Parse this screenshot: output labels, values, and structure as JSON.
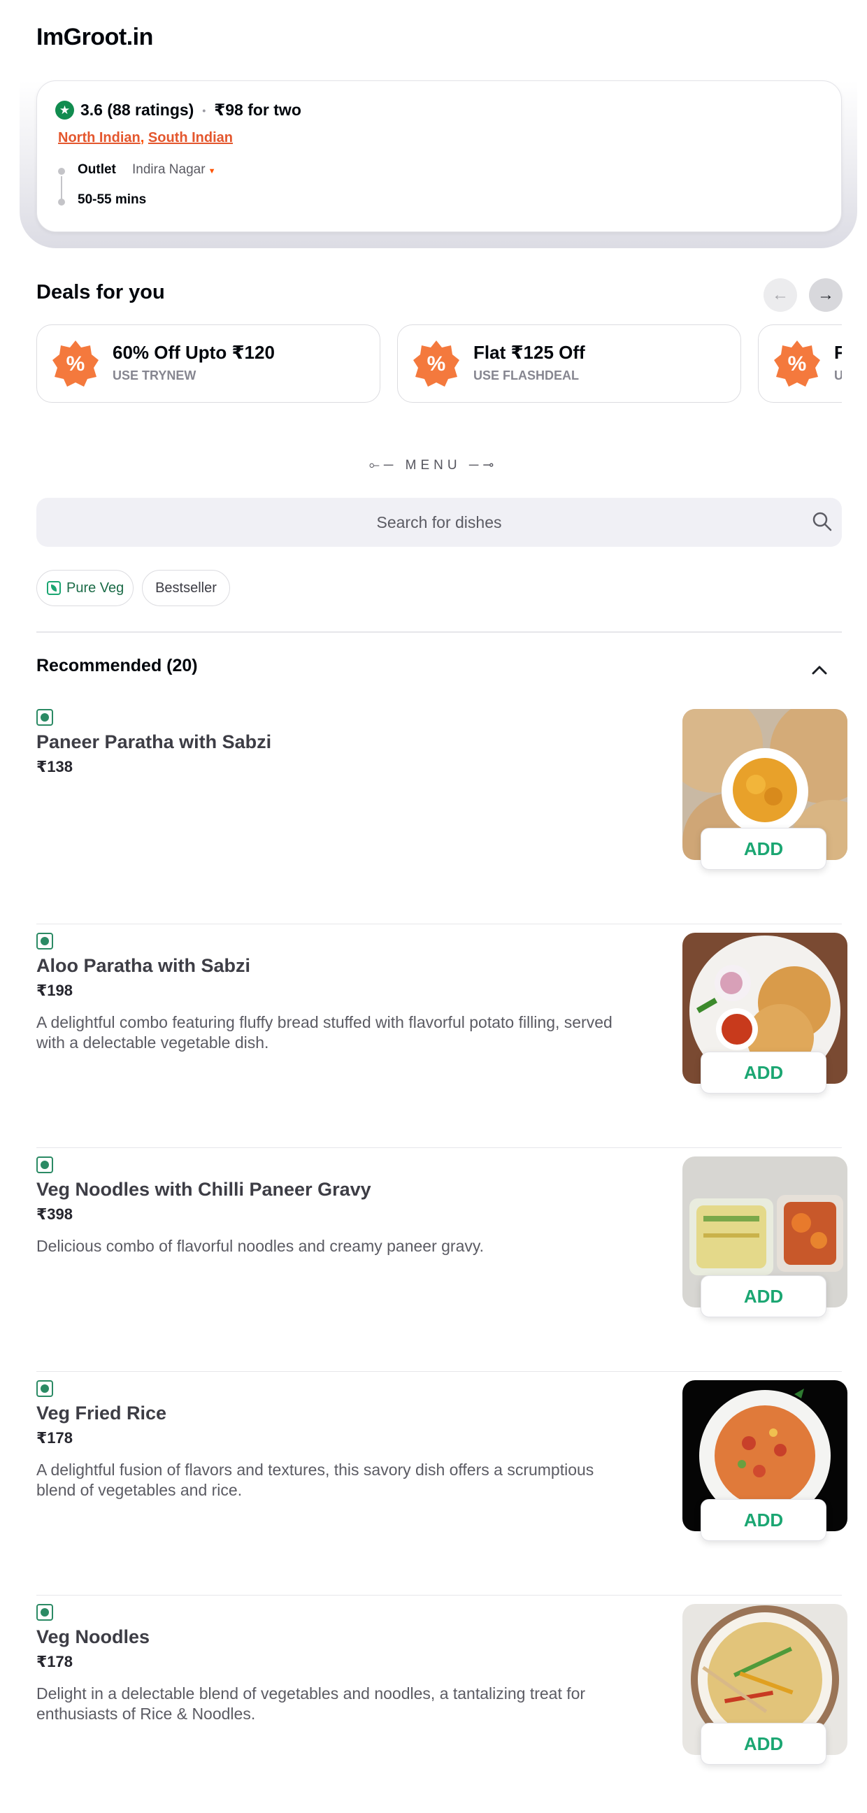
{
  "restaurant": {
    "name": "ImGroot.in",
    "rating": "3.6 (88 ratings)",
    "cost_for_two": "₹98 for two",
    "cuisines": [
      "North Indian",
      "South Indian"
    ],
    "cuisine_separator": ",",
    "outlet_label": "Outlet",
    "outlet_value": "Indira Nagar",
    "eta": "50-55 mins"
  },
  "deals": {
    "title": "Deals for you",
    "items": [
      {
        "title": "60% Off Upto ₹120",
        "code": "USE TRYNEW"
      },
      {
        "title": "Flat ₹125 Off",
        "code": "USE FLASHDEAL"
      },
      {
        "title": "F",
        "code": "U"
      }
    ]
  },
  "menu": {
    "label": "MENU",
    "search_placeholder": "Search for dishes",
    "filters": [
      {
        "label": "Pure Veg"
      },
      {
        "label": "Bestseller"
      }
    ],
    "section_title": "Recommended (20)",
    "add_label": "ADD",
    "dishes": [
      {
        "name": "Paneer Paratha with Sabzi",
        "price": "₹138",
        "description": ""
      },
      {
        "name": "Aloo Paratha with Sabzi",
        "price": "₹198",
        "description": "A delightful combo featuring fluffy bread stuffed with flavorful potato filling, served with a delectable vegetable dish."
      },
      {
        "name": "Veg Noodles with Chilli Paneer Gravy",
        "price": "₹398",
        "description": "Delicious combo of flavorful noodles and creamy paneer gravy."
      },
      {
        "name": "Veg Fried Rice",
        "price": "₹178",
        "description": "A delightful fusion of flavors and textures, this savory dish offers a scrumptious blend of vegetables and rice."
      },
      {
        "name": "Veg Noodles",
        "price": "₹178",
        "description": "Delight in a delectable blend of vegetables and noodles, a tantalizing treat for enthusiasts of Rice & Noodles."
      }
    ]
  },
  "colors": {
    "brand_orange": "#ff5200",
    "veg_green": "#1ba672",
    "rating_green": "#118c4f"
  }
}
